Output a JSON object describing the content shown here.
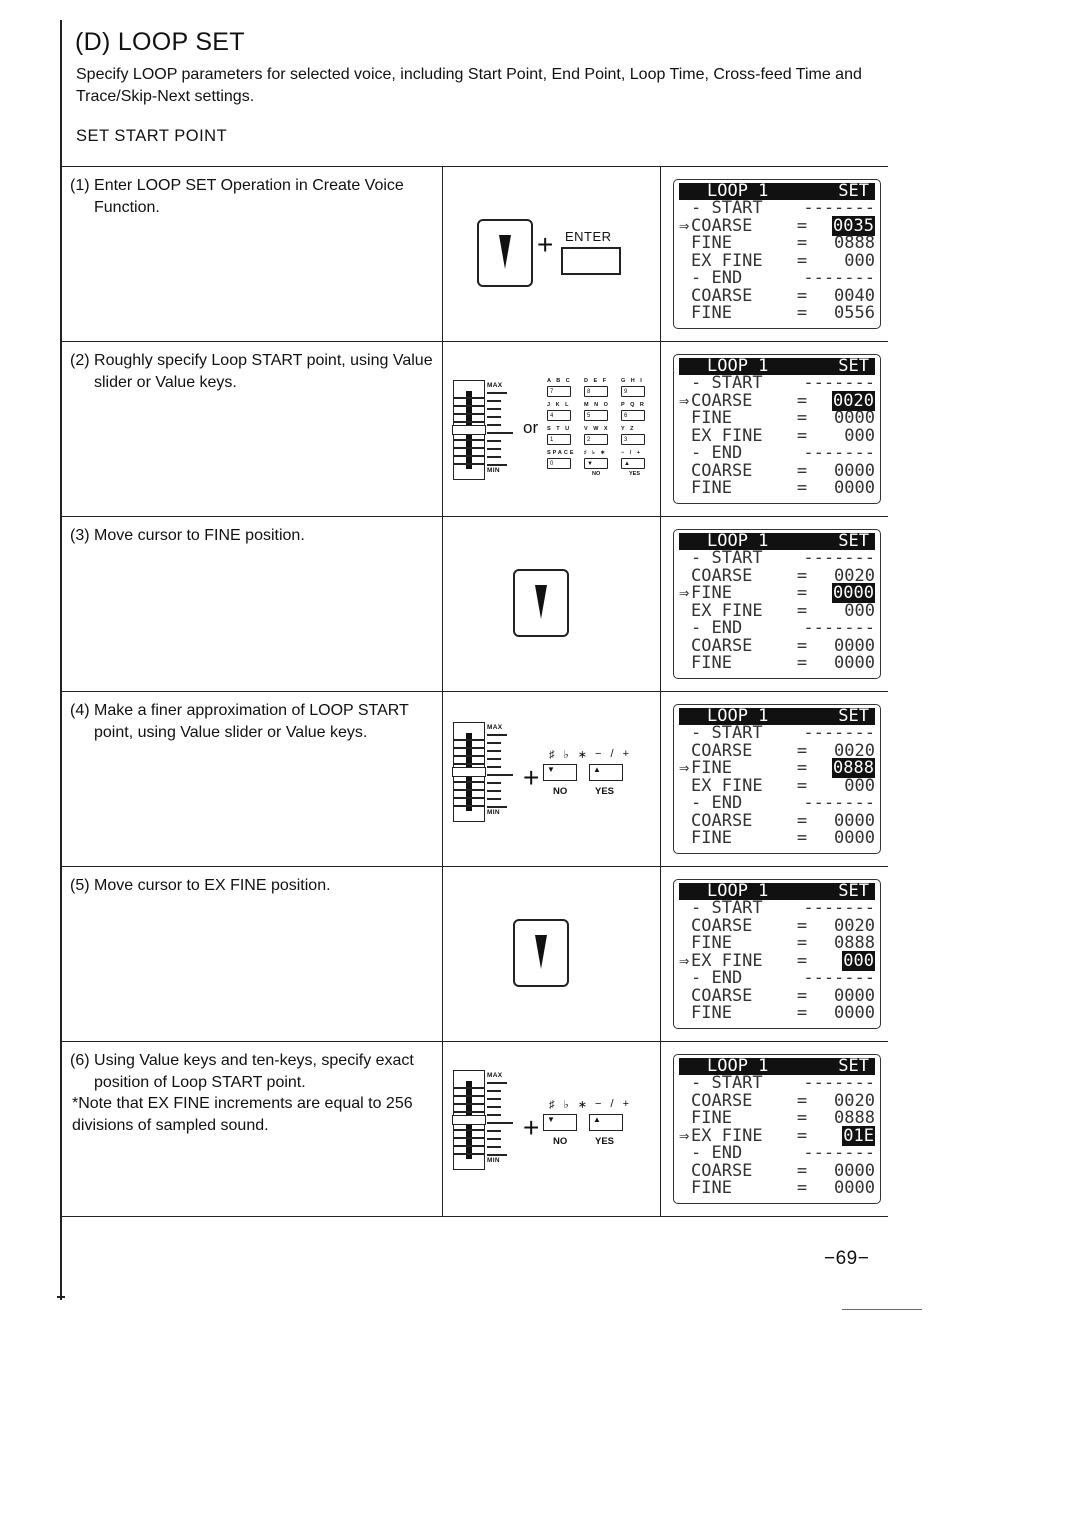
{
  "document": {
    "title": "(D) LOOP SET",
    "intro": "Specify LOOP parameters for selected voice, including Start Point, End Point, Loop Time, Cross-feed Time and Trace/Skip-Next settings.",
    "section_heading": "SET START POINT",
    "page_number": "−69−"
  },
  "key_labels": {
    "enter": "ENTER",
    "plus": "+",
    "or": "or",
    "max": "MAX",
    "min": "MIN",
    "no": "NO",
    "yes": "YES",
    "no_key_top": "♯ ♭ ∗",
    "yes_key_top": "− / +",
    "down_arrow": "▼",
    "up_arrow": "▲",
    "keypad": [
      {
        "top": "A B C",
        "face": "7"
      },
      {
        "top": "D E F",
        "face": "8"
      },
      {
        "top": "G H I",
        "face": "9"
      },
      {
        "top": "J K L",
        "face": "4"
      },
      {
        "top": "M N O",
        "face": "5"
      },
      {
        "top": "P Q R",
        "face": "6"
      },
      {
        "top": "S T U",
        "face": "1"
      },
      {
        "top": "V W X",
        "face": "2"
      },
      {
        "top": "Y Z",
        "face": "3"
      },
      {
        "top": "SPACE",
        "face": "0"
      },
      {
        "top": "♯ ♭ ∗",
        "face": "▼",
        "sub": "NO"
      },
      {
        "top": "− / +",
        "face": "▲",
        "sub": "YES"
      }
    ]
  },
  "lcd_common": {
    "title": "LOOP 1",
    "mode": "SET",
    "start_section": "- START",
    "end_section": "- END",
    "dashes": "-------",
    "coarse": "COARSE",
    "fine": "FINE",
    "ex_fine": "EX FINE",
    "equals": "=",
    "cursor": "⇒"
  },
  "steps": [
    {
      "number": "(1)",
      "text": "Enter LOOP SET Operation in Create Voice Function.",
      "keys": "cursor-down + ENTER",
      "lcd": {
        "cursor_on": "start_coarse",
        "start_coarse": "0035",
        "start_fine": "0888",
        "start_ex_fine": "000",
        "end_coarse": "0040",
        "end_fine": "0556"
      }
    },
    {
      "number": "(2)",
      "text": "Roughly specify Loop START point, using Value slider or Value keys.",
      "keys": "value slider or value keys",
      "lcd": {
        "cursor_on": "start_coarse",
        "start_coarse": "0020",
        "start_fine": "0000",
        "start_ex_fine": "000",
        "end_coarse": "0000",
        "end_fine": "0000"
      }
    },
    {
      "number": "(3)",
      "text": "Move cursor to FINE position.",
      "keys": "cursor-down",
      "lcd": {
        "cursor_on": "start_fine",
        "start_coarse": "0020",
        "start_fine": "0000",
        "start_ex_fine": "000",
        "end_coarse": "0000",
        "end_fine": "0000"
      }
    },
    {
      "number": "(4)",
      "text": "Make a finer approximation of LOOP START point, using Value slider or Value keys.",
      "keys": "value slider + NO/YES",
      "lcd": {
        "cursor_on": "start_fine",
        "start_coarse": "0020",
        "start_fine": "0888",
        "start_ex_fine": "000",
        "end_coarse": "0000",
        "end_fine": "0000"
      }
    },
    {
      "number": "(5)",
      "text": "Move cursor to EX FINE position.",
      "keys": "cursor-down",
      "lcd": {
        "cursor_on": "start_ex_fine",
        "start_coarse": "0020",
        "start_fine": "0888",
        "start_ex_fine": "000",
        "end_coarse": "0000",
        "end_fine": "0000"
      }
    },
    {
      "number": "(6)",
      "text": "Using Value keys and ten-keys, specify exact position of Loop START point.",
      "note": "*Note that EX FINE increments are equal to 256 divisions of sampled sound.",
      "keys": "value slider + NO/YES",
      "lcd": {
        "cursor_on": "start_ex_fine",
        "start_coarse": "0020",
        "start_fine": "0888",
        "start_ex_fine": "01E",
        "end_coarse": "0000",
        "end_fine": "0000"
      }
    }
  ]
}
